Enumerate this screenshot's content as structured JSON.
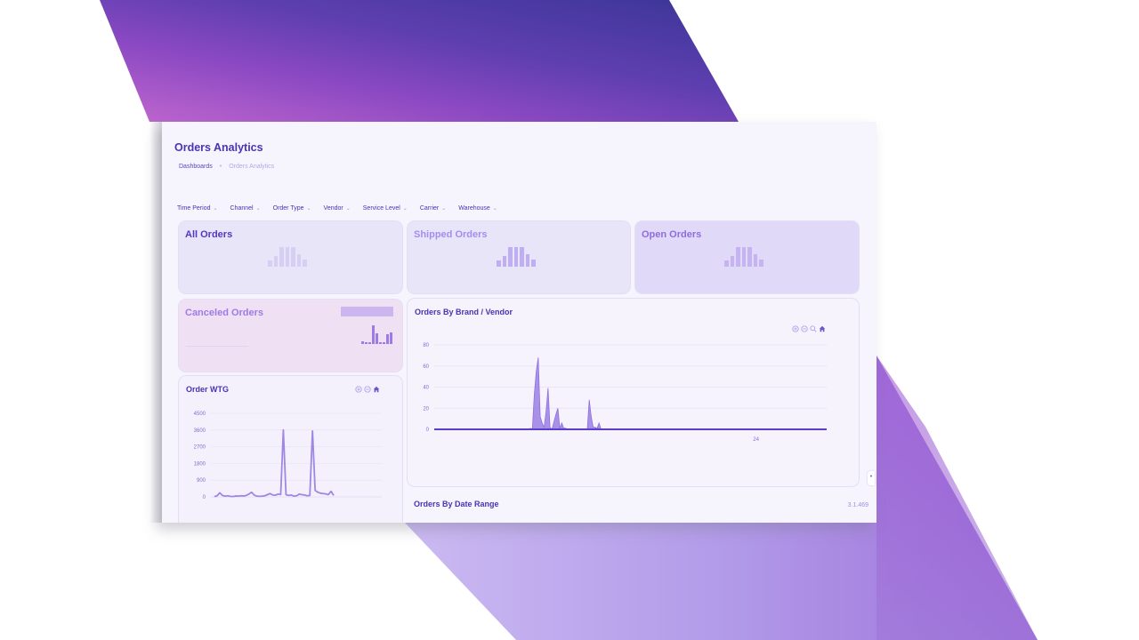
{
  "page": {
    "title": "Orders Analytics",
    "breadcrumb": [
      {
        "label": "Dashboards"
      },
      {
        "label": "•"
      },
      {
        "label": "Orders Analytics"
      }
    ],
    "version": "3.1.469"
  },
  "filters": [
    {
      "label": "Time Period",
      "icon": "chevron-down-icon"
    },
    {
      "label": "Channel",
      "icon": "chevron-down-icon"
    },
    {
      "label": "Order Type",
      "icon": "chevron-down-icon"
    },
    {
      "label": "Vendor",
      "icon": "chevron-down-icon"
    },
    {
      "label": "Service Level",
      "icon": "chevron-down-icon"
    },
    {
      "label": "Carrier",
      "icon": "chevron-down-icon"
    },
    {
      "label": "Warehouse",
      "icon": "chevron-down-icon"
    }
  ],
  "chevron_glyph": "⌄",
  "kpi_cards": [
    {
      "title": "All Orders",
      "title_color": "#5436c0",
      "bg": "#e8e5f8",
      "bar_color": "#d6cff3",
      "loading_bars": [
        0.3,
        0.55,
        1,
        1,
        1,
        0.65,
        0.35
      ]
    },
    {
      "title": "Shipped Orders",
      "title_color": "#a58cf0",
      "bg": "#e8e5f8",
      "bar_color": "#bfaef2",
      "loading_bars": [
        0.3,
        0.55,
        1,
        1,
        1,
        0.65,
        0.35
      ]
    },
    {
      "title": "Open Orders",
      "title_color": "#8f6be0",
      "bg": "#e1d9f8",
      "bar_color": "#c6b3f2",
      "loading_bars": [
        0.3,
        0.55,
        1,
        1,
        1,
        0.65,
        0.35
      ]
    },
    {
      "title": "Canceled Orders",
      "title_color": "#9f7ae8",
      "bg": "#f0e0f4",
      "bar_color": "#9d7ae6",
      "loading_bars": [
        0.15,
        0.1,
        0.1,
        0.95,
        0.55,
        0.1,
        0.1,
        0.5,
        0.6
      ]
    }
  ],
  "order_wtg": {
    "title": "Order WTG",
    "tools": [
      "zoom-in-icon",
      "zoom-out-icon",
      "home-icon"
    ],
    "chart_data": {
      "type": "line",
      "title": "Order WTG",
      "ylim": [
        0,
        4500
      ],
      "yticks": [
        0,
        900,
        1800,
        2700,
        3600,
        4500
      ],
      "ytick_labels": [
        "0",
        "900",
        "1800",
        "2700",
        "3600",
        "4500"
      ],
      "grid": true,
      "series": [
        {
          "name": "Order WTG",
          "color": "#9f88e3",
          "values": [
            20,
            60,
            220,
            80,
            40,
            60,
            30,
            20,
            50,
            40,
            60,
            50,
            80,
            150,
            250,
            100,
            40,
            30,
            40,
            60,
            120,
            180,
            100,
            90,
            150,
            130,
            3600,
            120,
            80,
            100,
            40,
            60,
            150,
            120,
            100,
            60,
            80,
            3550,
            350,
            250,
            200,
            180,
            160,
            120,
            300,
            80
          ]
        }
      ]
    }
  },
  "orders_by_brand": {
    "title": "Orders By Brand / Vendor",
    "tools": [
      "zoom-in-icon",
      "zoom-out-icon",
      "magnify-icon",
      "home-icon"
    ],
    "chart_data": {
      "type": "area",
      "title": "Orders By Brand / Vendor",
      "ylim": [
        0,
        80
      ],
      "yticks": [
        0,
        20,
        40,
        60,
        80
      ],
      "ytick_labels": [
        "0",
        "20",
        "40",
        "60",
        "80"
      ],
      "xtick_labels": [
        {
          "label": "24",
          "position": 0.82
        }
      ],
      "grid": true,
      "series": [
        {
          "name": "Orders",
          "color": "#9a7fe3",
          "points": [
            [
              0.0,
              0
            ],
            [
              0.24,
              0
            ],
            [
              0.245,
              1
            ],
            [
              0.25,
              0
            ],
            [
              0.255,
              33
            ],
            [
              0.26,
              55
            ],
            [
              0.265,
              68
            ],
            [
              0.27,
              12
            ],
            [
              0.275,
              6
            ],
            [
              0.28,
              2
            ],
            [
              0.285,
              17
            ],
            [
              0.29,
              39
            ],
            [
              0.295,
              2
            ],
            [
              0.3,
              0
            ],
            [
              0.31,
              14
            ],
            [
              0.315,
              20
            ],
            [
              0.32,
              1
            ],
            [
              0.325,
              6
            ],
            [
              0.33,
              1
            ],
            [
              0.335,
              1
            ],
            [
              0.34,
              0
            ],
            [
              0.39,
              0
            ],
            [
              0.395,
              28
            ],
            [
              0.4,
              12
            ],
            [
              0.405,
              2
            ],
            [
              0.41,
              2
            ],
            [
              0.415,
              1
            ],
            [
              0.42,
              6
            ],
            [
              0.425,
              0
            ],
            [
              1.0,
              0
            ]
          ]
        }
      ]
    }
  },
  "orders_by_date_range": {
    "title": "Orders By Date Range"
  },
  "side_handle_glyph": "•"
}
